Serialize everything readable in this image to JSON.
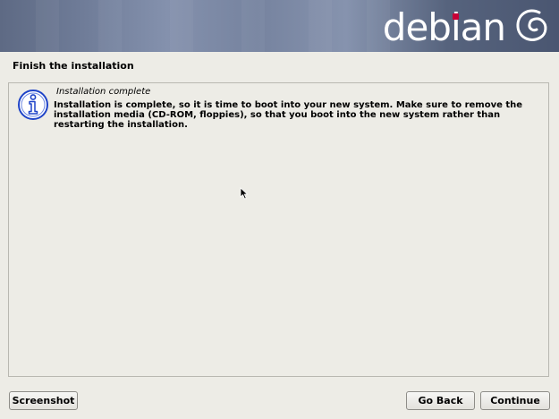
{
  "banner": {
    "logo_text_before": "deb",
    "logo_text_i": "i",
    "logo_text_after": "an",
    "swirl_icon": "debian-swirl-icon",
    "accent_color": "#c70036"
  },
  "page": {
    "title": "Finish the installation"
  },
  "message": {
    "icon": "info-icon",
    "title": "Installation complete",
    "body": "Installation is complete, so it is time to boot into your new system. Make sure to remove the installation media (CD-ROM, floppies), so that you boot into the new system rather than restarting the installation."
  },
  "buttons": {
    "screenshot": "Screenshot",
    "go_back": "Go Back",
    "continue": "Continue"
  }
}
